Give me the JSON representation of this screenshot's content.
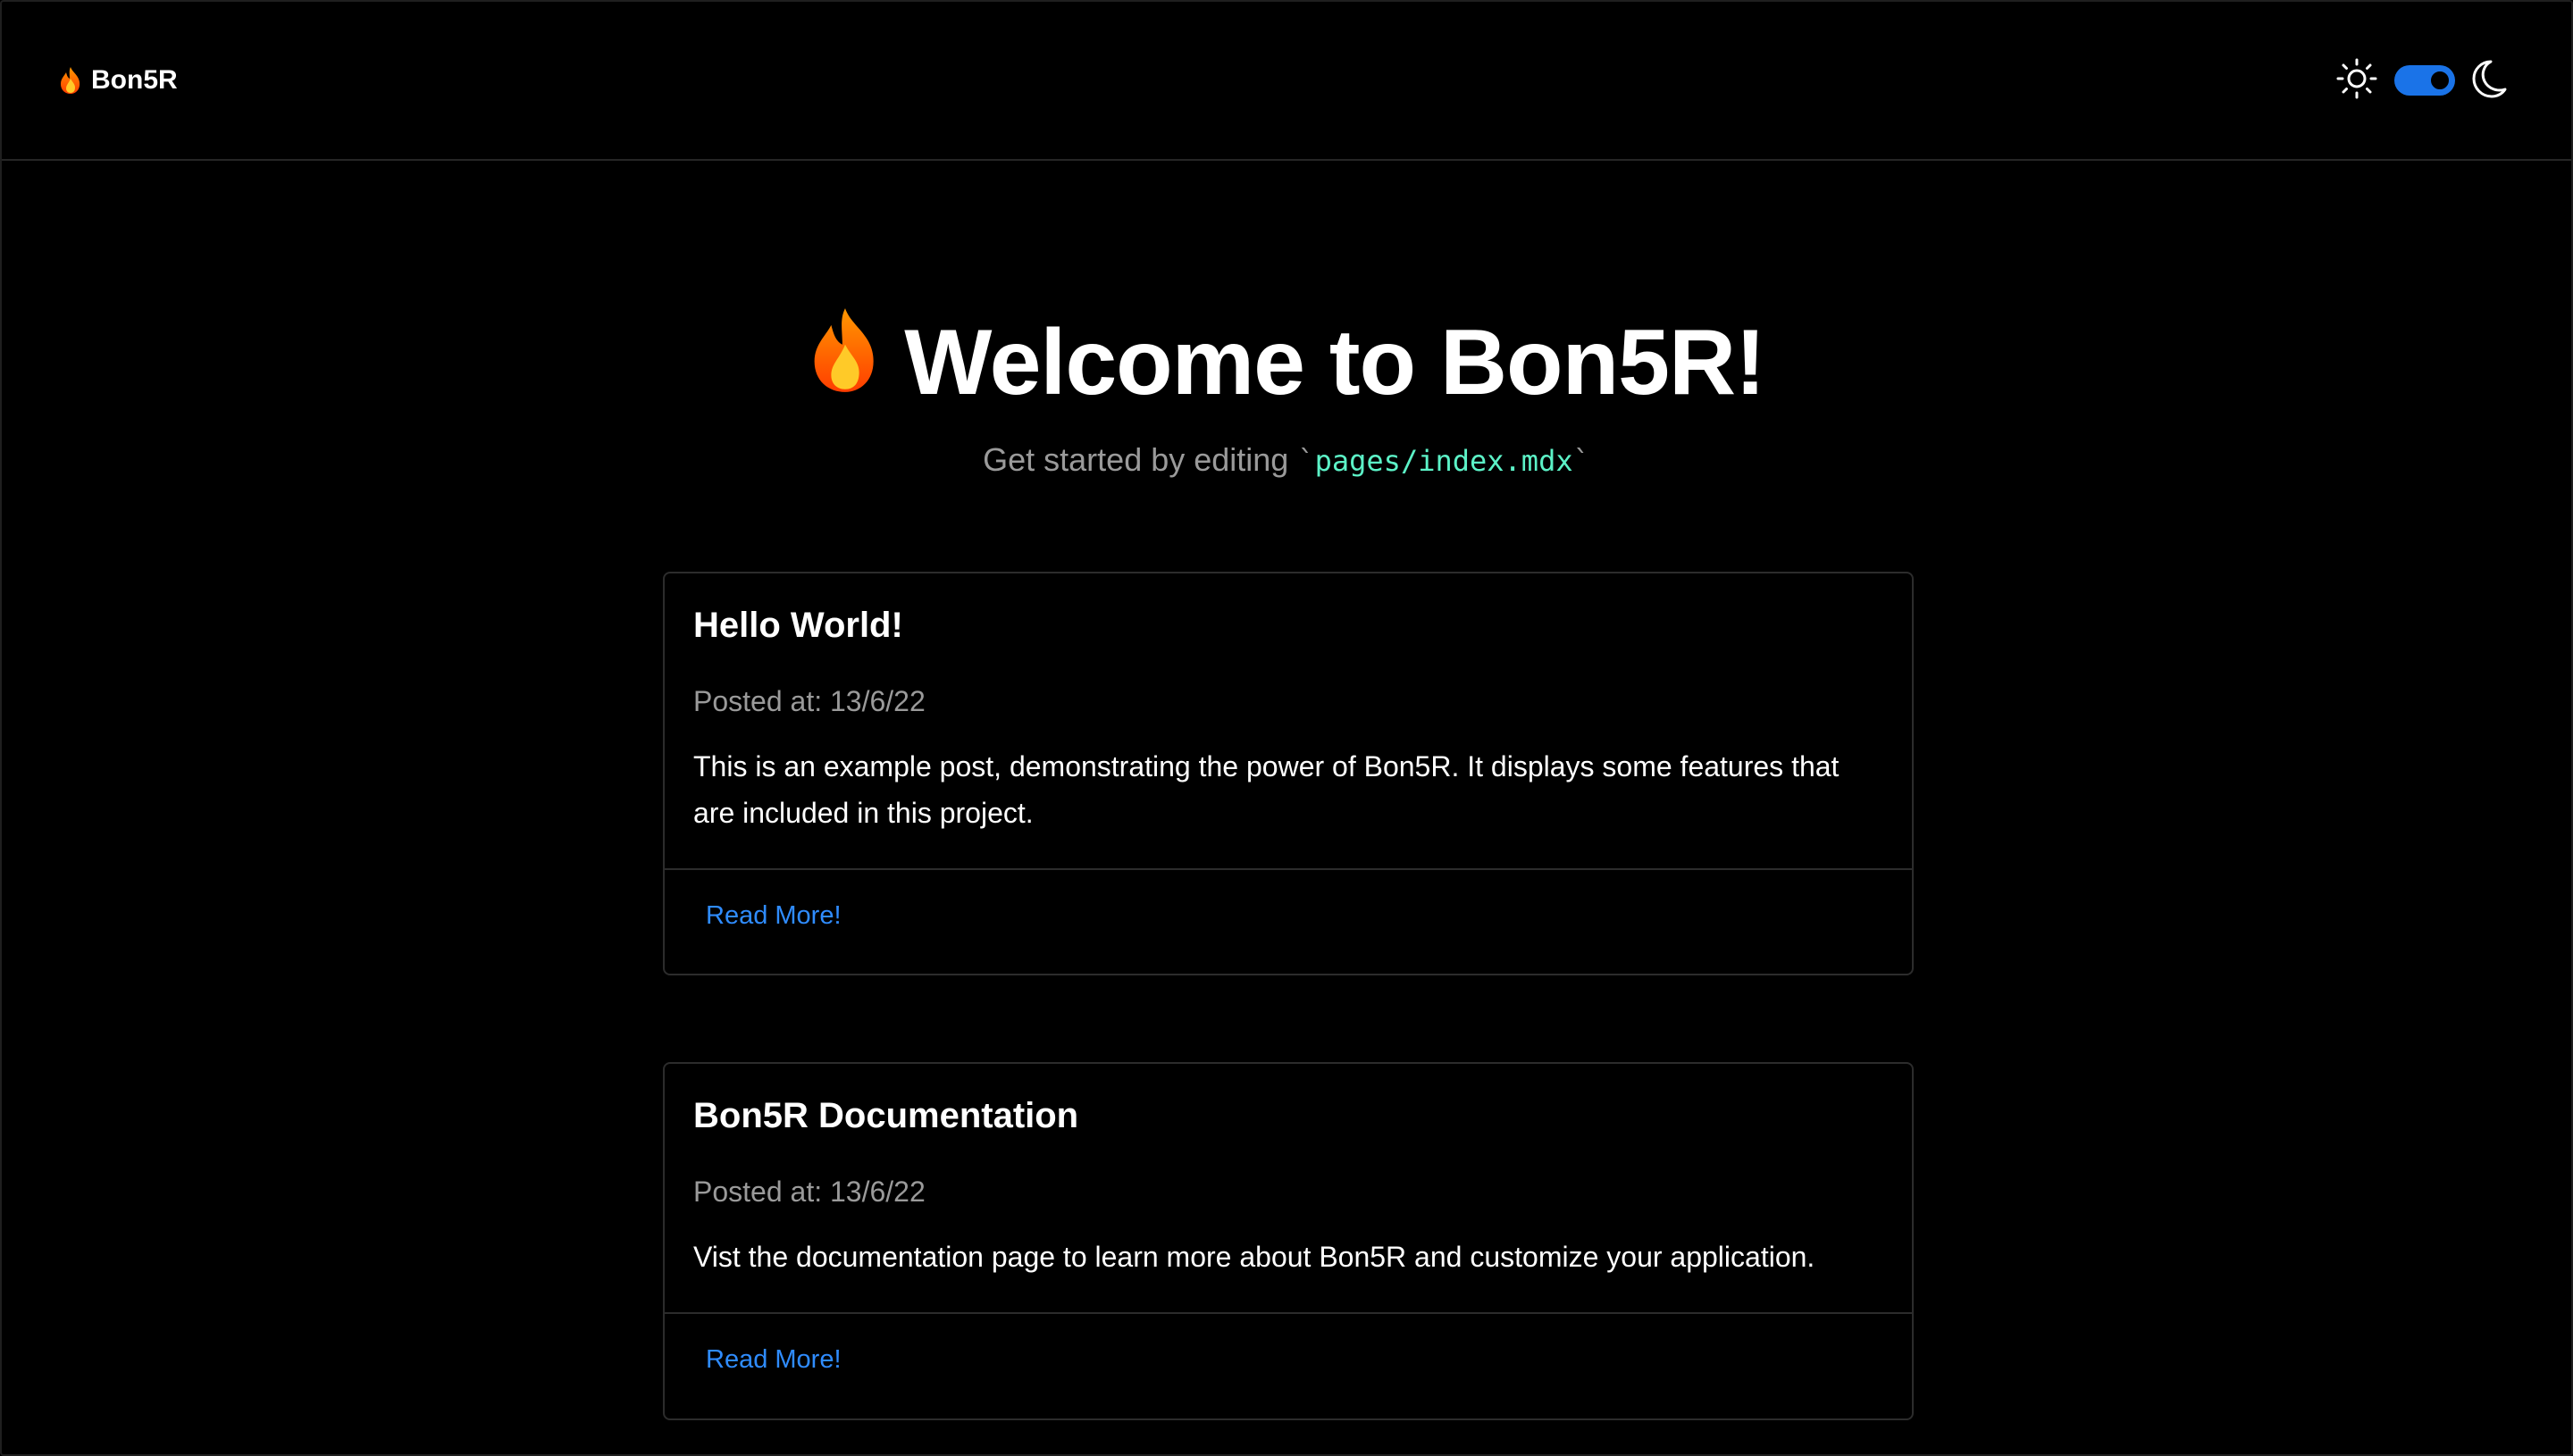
{
  "header": {
    "brand_emoji": "🔥",
    "brand_name": "Bon5R",
    "icons": [
      "sun-icon",
      "moon-icon"
    ],
    "theme_toggle_state": "dark",
    "accent_color": "#1a73e8"
  },
  "hero": {
    "emoji": "🔥",
    "title": "Welcome to Bon5R!",
    "subtitle_text": "Get started by editing",
    "subtitle_code": "pages/index.mdx",
    "code_color": "#5cf2c7"
  },
  "posts": [
    {
      "title": "Hello World!",
      "date": "Posted at: 13/6/22",
      "excerpt": "This is an example post, demonstrating the power of Bon5R. It displays some features that are included in this project.",
      "link_label": "Read More!"
    },
    {
      "title": "Bon5R Documentation",
      "date": "Posted at: 13/6/22",
      "excerpt": "Vist the documentation page to learn more about Bon5R and customize your application.",
      "link_label": "Read More!"
    }
  ],
  "link_color": "#2f8cff"
}
